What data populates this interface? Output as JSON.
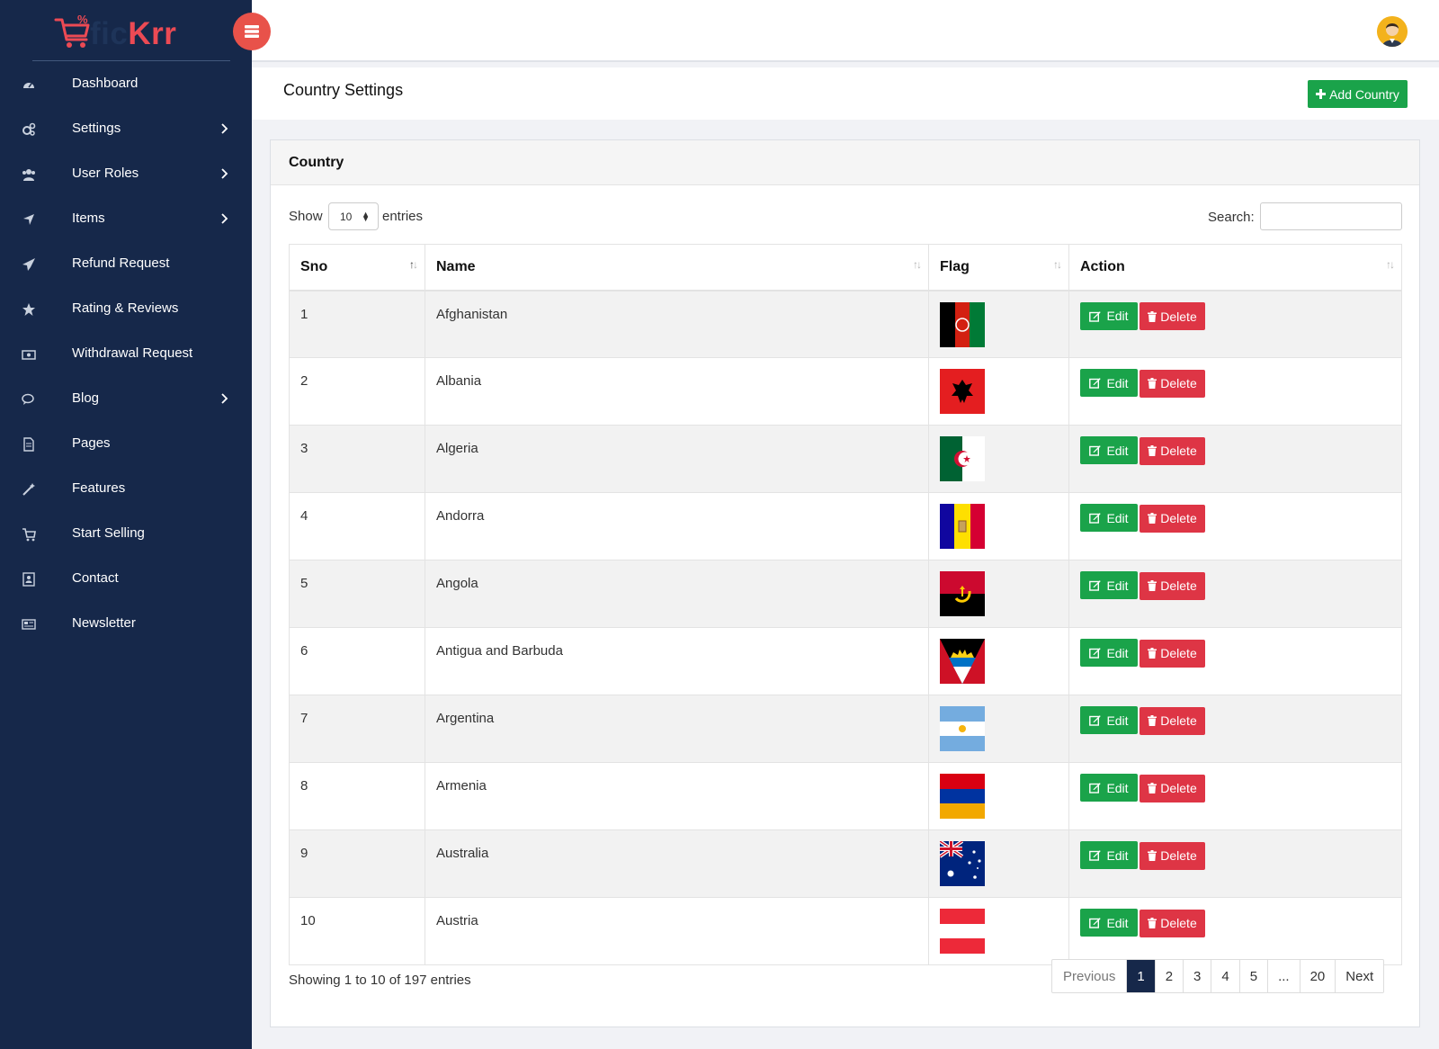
{
  "brand": {
    "name_part1": "fic",
    "name_part2": "Krr"
  },
  "sidebar": {
    "items": [
      {
        "label": "Dashboard",
        "icon": "dashboard-icon",
        "has_submenu": false
      },
      {
        "label": "Settings",
        "icon": "gears-icon",
        "has_submenu": true
      },
      {
        "label": "User Roles",
        "icon": "users-icon",
        "has_submenu": true
      },
      {
        "label": "Items",
        "icon": "location-arrow-icon",
        "has_submenu": true
      },
      {
        "label": "Refund Request",
        "icon": "paper-plane-icon",
        "has_submenu": false
      },
      {
        "label": "Rating & Reviews",
        "icon": "star-icon",
        "has_submenu": false
      },
      {
        "label": "Withdrawal Request",
        "icon": "money-icon",
        "has_submenu": false
      },
      {
        "label": "Blog",
        "icon": "comments-icon",
        "has_submenu": true
      },
      {
        "label": "Pages",
        "icon": "file-icon",
        "has_submenu": false
      },
      {
        "label": "Features",
        "icon": "magic-wand-icon",
        "has_submenu": false
      },
      {
        "label": "Start Selling",
        "icon": "cart-icon",
        "has_submenu": false
      },
      {
        "label": "Contact",
        "icon": "contact-card-icon",
        "has_submenu": false
      },
      {
        "label": "Newsletter",
        "icon": "newspaper-icon",
        "has_submenu": false
      }
    ]
  },
  "page": {
    "title": "Country Settings",
    "add_button_label": "Add Country"
  },
  "card": {
    "title": "Country",
    "show_label": "Show",
    "page_length": "10",
    "entries_label": "entries",
    "search_label": "Search:",
    "search_value": ""
  },
  "table": {
    "headers": [
      "Sno",
      "Name",
      "Flag",
      "Action"
    ],
    "edit_label": "Edit",
    "delete_label": "Delete",
    "rows": [
      {
        "sno": "1",
        "name": "Afghanistan",
        "flag": "afghanistan-flag"
      },
      {
        "sno": "2",
        "name": "Albania",
        "flag": "albania-flag"
      },
      {
        "sno": "3",
        "name": "Algeria",
        "flag": "algeria-flag"
      },
      {
        "sno": "4",
        "name": "Andorra",
        "flag": "andorra-flag"
      },
      {
        "sno": "5",
        "name": "Angola",
        "flag": "angola-flag"
      },
      {
        "sno": "6",
        "name": "Antigua and Barbuda",
        "flag": "antigua-flag"
      },
      {
        "sno": "7",
        "name": "Argentina",
        "flag": "argentina-flag"
      },
      {
        "sno": "8",
        "name": "Armenia",
        "flag": "armenia-flag"
      },
      {
        "sno": "9",
        "name": "Australia",
        "flag": "australia-flag"
      },
      {
        "sno": "10",
        "name": "Austria",
        "flag": "austria-flag"
      }
    ]
  },
  "footer": {
    "info": "Showing 1 to 10 of 197 entries",
    "pagination": [
      "Previous",
      "1",
      "2",
      "3",
      "4",
      "5",
      "...",
      "20",
      "Next"
    ],
    "active_page": "1"
  },
  "colors": {
    "sidebar_bg": "#16284a",
    "accent_red": "#e8524a",
    "success_green": "#1aa34a",
    "danger_red": "#de3545"
  }
}
